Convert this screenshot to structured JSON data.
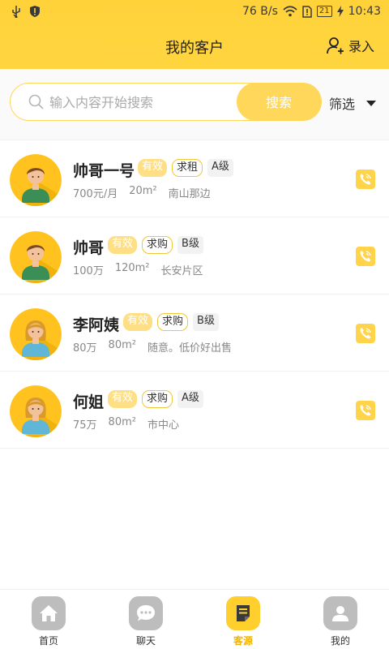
{
  "status": {
    "speed": "76 B/s",
    "battery": "21",
    "time": "10:43"
  },
  "header": {
    "title": "我的客户",
    "enter_label": "录入"
  },
  "search": {
    "placeholder": "输入内容开始搜索",
    "button_label": "搜索",
    "filter_label": "筛选"
  },
  "customers": [
    {
      "name": "帅哥一号",
      "valid": "有效",
      "type": "求租",
      "level": "A级",
      "price": "700元/月",
      "area": "20m²",
      "location": "南山那边",
      "avatar": "male"
    },
    {
      "name": "帅哥",
      "valid": "有效",
      "type": "求购",
      "level": "B级",
      "price": "100万",
      "area": "120m²",
      "location": "长安片区",
      "avatar": "male"
    },
    {
      "name": "李阿姨",
      "valid": "有效",
      "type": "求购",
      "level": "B级",
      "price": "80万",
      "area": "80m²",
      "location": "随意。低价好出售",
      "avatar": "female"
    },
    {
      "name": "何姐",
      "valid": "有效",
      "type": "求购",
      "level": "A级",
      "price": "75万",
      "area": "80m²",
      "location": "市中心",
      "avatar": "female"
    }
  ],
  "tabs": [
    {
      "label": "首页",
      "icon": "home-icon",
      "active": false
    },
    {
      "label": "聊天",
      "icon": "chat-icon",
      "active": false
    },
    {
      "label": "客源",
      "icon": "client-source-icon",
      "active": true
    },
    {
      "label": "我的",
      "icon": "profile-icon",
      "active": false
    }
  ],
  "colors": {
    "brand_yellow": "#ffd23a",
    "tag_valid": "#ffdf85",
    "tab_active": "#ffcf2d",
    "tab_inactive": "#bdbdbd"
  }
}
